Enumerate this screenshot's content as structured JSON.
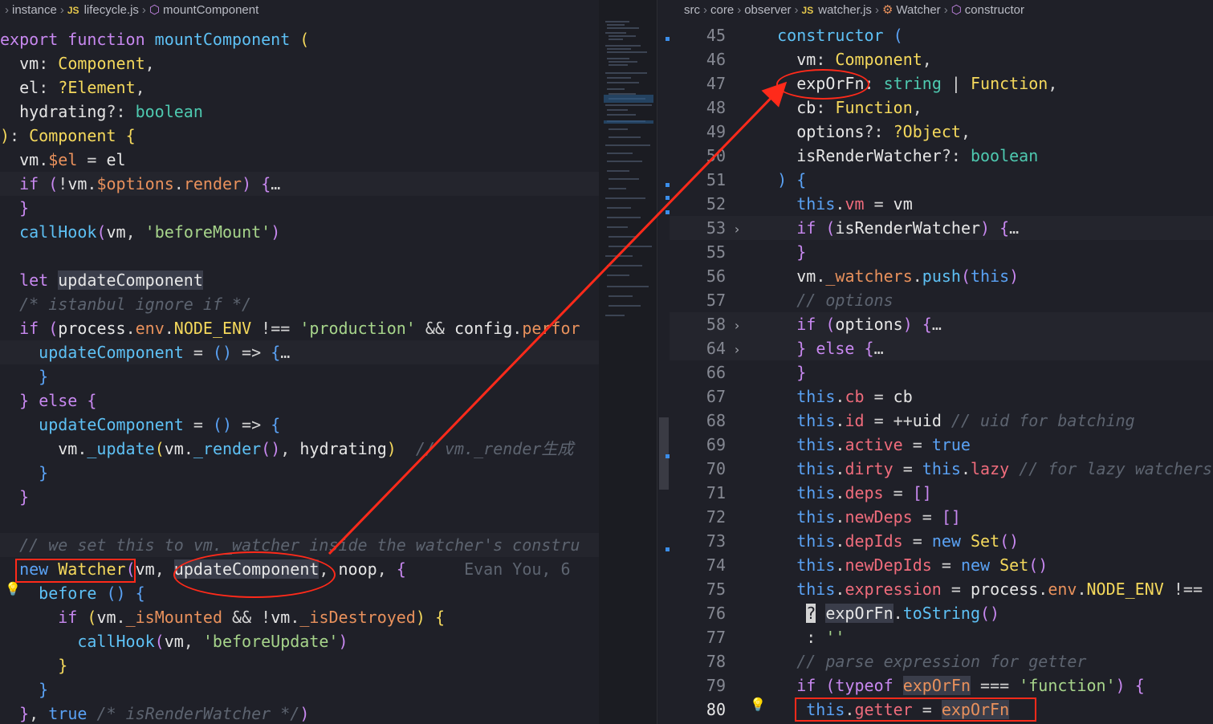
{
  "left_breadcrumb": {
    "items": [
      "instance",
      "lifecycle.js",
      "mountComponent"
    ]
  },
  "right_breadcrumb": {
    "items": [
      "src",
      "core",
      "observer",
      "watcher.js",
      "Watcher",
      "constructor"
    ]
  },
  "left_code": {
    "blame": "Evan You, 6",
    "comment_istanbul": "/* istanbul ignore if */",
    "comment_render": "// vm._render生成",
    "comment_watcher": "// we set this to vm._watcher inside the watcher's constru",
    "comment_isrender": "/* isRenderWatcher */"
  },
  "right_code": {
    "line_numbers": [
      "45",
      "46",
      "47",
      "48",
      "49",
      "50",
      "51",
      "52",
      "53",
      "55",
      "56",
      "57",
      "58",
      "64",
      "66",
      "67",
      "68",
      "69",
      "70",
      "71",
      "72",
      "73",
      "74",
      "75",
      "76",
      "77",
      "78",
      "79",
      "80"
    ],
    "comment_options": "// options",
    "comment_uid": "// uid for batching",
    "comment_lazy": "// for lazy watchers",
    "comment_parse": "// parse expression for getter"
  },
  "colors": {
    "annotation": "#ff2a1a",
    "background": "#1f2028"
  }
}
